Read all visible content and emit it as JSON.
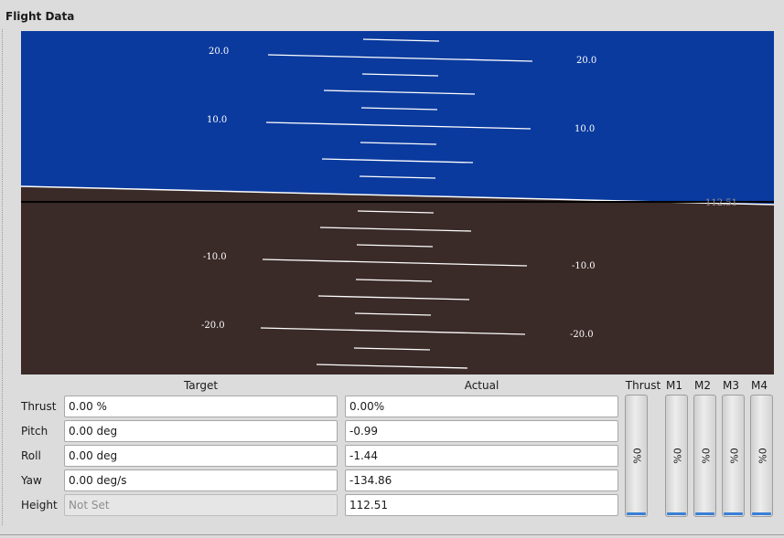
{
  "panel": {
    "title": "Flight Data"
  },
  "horizon": {
    "sky_color": "#0a3a9e",
    "ground_color": "#3a2a28",
    "line_color": "#ffffff",
    "labels": {
      "p20l": "20.0",
      "p20r": "20.0",
      "p10l": "10.0",
      "p10r": "10.0",
      "n10l": "-10.0",
      "n10r": "-10.0",
      "n20l": "-20.0",
      "n20r": "-20.0"
    },
    "height_readout": "112.51"
  },
  "columns": {
    "target": "Target",
    "actual": "Actual"
  },
  "rows": {
    "thrust": {
      "label": "Thrust",
      "target": "0.00 %",
      "actual": "0.00%"
    },
    "pitch": {
      "label": "Pitch",
      "target": "0.00 deg",
      "actual": "-0.99"
    },
    "roll": {
      "label": "Roll",
      "target": "0.00 deg",
      "actual": "-1.44"
    },
    "yaw": {
      "label": "Yaw",
      "target": "0.00 deg/s",
      "actual": "-134.86"
    },
    "height": {
      "label": "Height",
      "target_placeholder": "Not Set",
      "actual": "112.51"
    }
  },
  "bars": {
    "thrust": {
      "label": "Thrust",
      "value": "0%",
      "level_percent": 0
    },
    "m1": {
      "label": "M1",
      "value": "0%",
      "level_percent": 0
    },
    "m2": {
      "label": "M2",
      "value": "0%",
      "level_percent": 0
    },
    "m3": {
      "label": "M3",
      "value": "0%",
      "level_percent": 0
    },
    "m4": {
      "label": "M4",
      "value": "0%",
      "level_percent": 0
    }
  },
  "colors": {
    "bar_fill": "#3a7fd6"
  }
}
